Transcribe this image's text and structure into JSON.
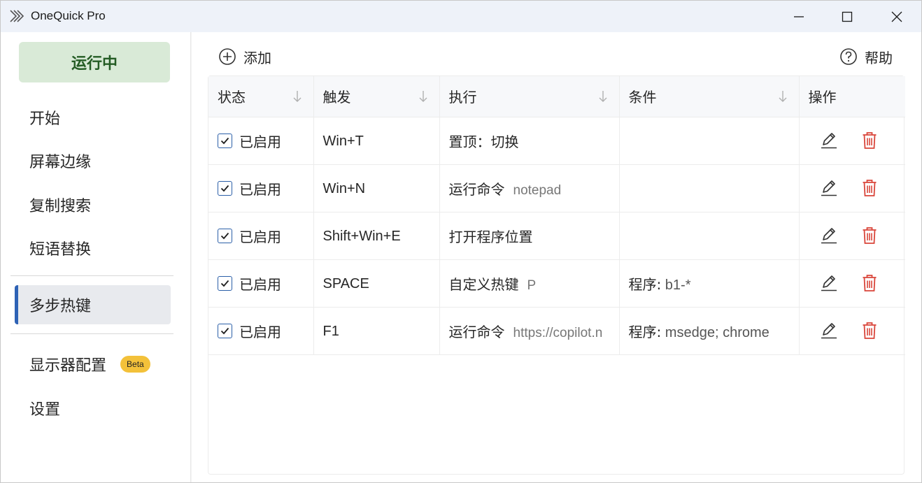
{
  "window": {
    "title": "OneQuick Pro"
  },
  "sidebar": {
    "status": "运行中",
    "items": [
      {
        "label": "开始"
      },
      {
        "label": "屏幕边缘"
      },
      {
        "label": "复制搜索"
      },
      {
        "label": "短语替换"
      },
      {
        "label": "多步热键"
      },
      {
        "label": "显示器配置",
        "badge": "Beta"
      },
      {
        "label": "设置"
      }
    ]
  },
  "toolbar": {
    "add_label": "添加",
    "help_label": "帮助"
  },
  "table": {
    "headers": [
      "状态",
      "触发",
      "执行",
      "条件",
      "操作"
    ],
    "rows": [
      {
        "status": "已启用",
        "trigger": "Win+T",
        "exec": "置顶：切换",
        "exec_arg": "",
        "cond": ""
      },
      {
        "status": "已启用",
        "trigger": "Win+N",
        "exec": "运行命令",
        "exec_arg": "notepad",
        "cond": ""
      },
      {
        "status": "已启用",
        "trigger": "Shift+Win+E",
        "exec": "打开程序位置",
        "exec_arg": "",
        "cond": ""
      },
      {
        "status": "已启用",
        "trigger": "SPACE",
        "exec": "自定义热键",
        "exec_arg": "P",
        "cond": "程序: b1-*"
      },
      {
        "status": "已启用",
        "trigger": "F1",
        "exec": "运行命令",
        "exec_arg": "https://copilot.n",
        "cond": "程序: msedge; chrome"
      }
    ]
  },
  "colors": {
    "accent": "#2e62b5",
    "running_bg": "#d9ead7",
    "running_text": "#245c24",
    "delete": "#d9453a",
    "beta": "#f3c13a"
  }
}
